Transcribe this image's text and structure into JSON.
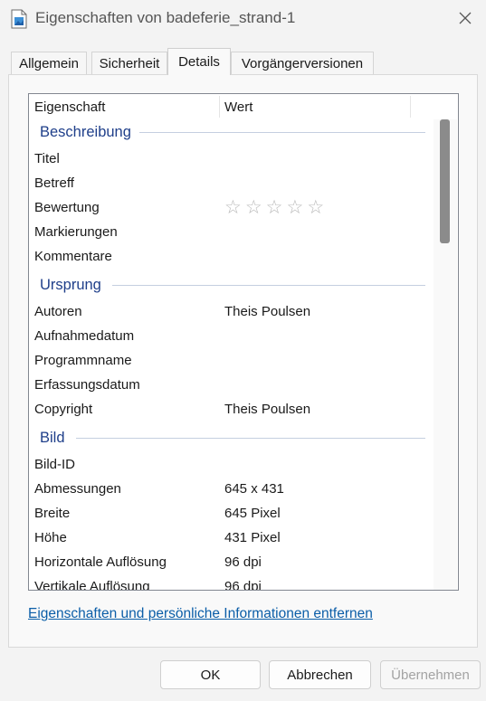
{
  "window": {
    "title": "Eigenschaften von badeferie_strand-1"
  },
  "tabs": [
    {
      "label": "Allgemein"
    },
    {
      "label": "Sicherheit"
    },
    {
      "label": "Details"
    },
    {
      "label": "Vorgängerversionen"
    }
  ],
  "active_tab": "Details",
  "table": {
    "columns": {
      "property": "Eigenschaft",
      "value": "Wert"
    },
    "groups": {
      "beschreibung": {
        "label": "Beschreibung",
        "rows": [
          {
            "property": "Titel",
            "value": ""
          },
          {
            "property": "Betreff",
            "value": ""
          },
          {
            "property": "Bewertung",
            "value": ""
          },
          {
            "property": "Markierungen",
            "value": ""
          },
          {
            "property": "Kommentare",
            "value": ""
          }
        ]
      },
      "ursprung": {
        "label": "Ursprung",
        "rows": [
          {
            "property": "Autoren",
            "value": "Theis Poulsen"
          },
          {
            "property": "Aufnahmedatum",
            "value": ""
          },
          {
            "property": "Programmname",
            "value": ""
          },
          {
            "property": "Erfassungsdatum",
            "value": ""
          },
          {
            "property": "Copyright",
            "value": "Theis Poulsen"
          }
        ]
      },
      "bild": {
        "label": "Bild",
        "rows": [
          {
            "property": "Bild-ID",
            "value": ""
          },
          {
            "property": "Abmessungen",
            "value": "645 x 431"
          },
          {
            "property": "Breite",
            "value": "645 Pixel"
          },
          {
            "property": "Höhe",
            "value": "431 Pixel"
          },
          {
            "property": "Horizontale Auflösung",
            "value": "96 dpi"
          },
          {
            "property": "Vertikale Auflösung",
            "value": "96 dpi"
          }
        ]
      }
    },
    "rating": {
      "stars_filled": 0,
      "stars_total": 5,
      "glyph": "☆"
    }
  },
  "remove_link": "Eigenschaften und persönliche Informationen entfernen",
  "buttons": {
    "ok": "OK",
    "cancel": "Abbrechen",
    "apply": "Übernehmen"
  },
  "colors": {
    "group_header": "#1f3f8a",
    "link": "#0b5ea8",
    "disabled_text": "#a3a3a3"
  }
}
